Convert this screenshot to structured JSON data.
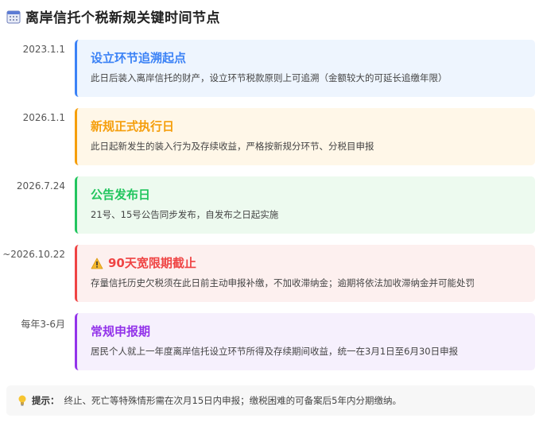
{
  "header": {
    "title": "离岸信托个税新规关键时间节点",
    "icon": "calendar-icon"
  },
  "timeline": [
    {
      "date": "2023.1.1",
      "title": "设立环节追溯起点",
      "desc": "此日后装入离岸信托的财产，设立环节税款原则上可追溯（金额较大的可延长追缴年限）",
      "color": "#3b82f6",
      "bg": "#eef5fe",
      "icon": ""
    },
    {
      "date": "2026.1.1",
      "title": "新规正式执行日",
      "desc": "此日起新发生的装入行为及存续收益，严格按新规分环节、分税目申报",
      "color": "#f59e0b",
      "bg": "#fff7e8",
      "icon": ""
    },
    {
      "date": "2026.7.24",
      "title": "公告发布日",
      "desc": "21号、15号公告同步发布，自发布之日起实施",
      "color": "#22c55e",
      "bg": "#edfaef",
      "icon": ""
    },
    {
      "date": "~2026.10.22",
      "title": "90天宽限期截止",
      "desc": "存量信托历史欠税须在此日前主动申报补缴，不加收滞纳金；逾期将依法加收滞纳金并可能处罚",
      "color": "#ef4444",
      "bg": "#fdf0ef",
      "icon": "warning-icon"
    },
    {
      "date": "每年3-6月",
      "title": "常规申报期",
      "desc": "居民个人就上一年度离岸信托设立环节所得及存续期间收益，统一在3月1日至6月30日申报",
      "color": "#9333ea",
      "bg": "#f6f0fd",
      "icon": ""
    }
  ],
  "tip": {
    "label": "提示：",
    "text": "终止、死亡等特殊情形需在次月15日内申报；缴税困难的可备案后5年内分期缴纳。",
    "icon": "lightbulb-icon"
  }
}
